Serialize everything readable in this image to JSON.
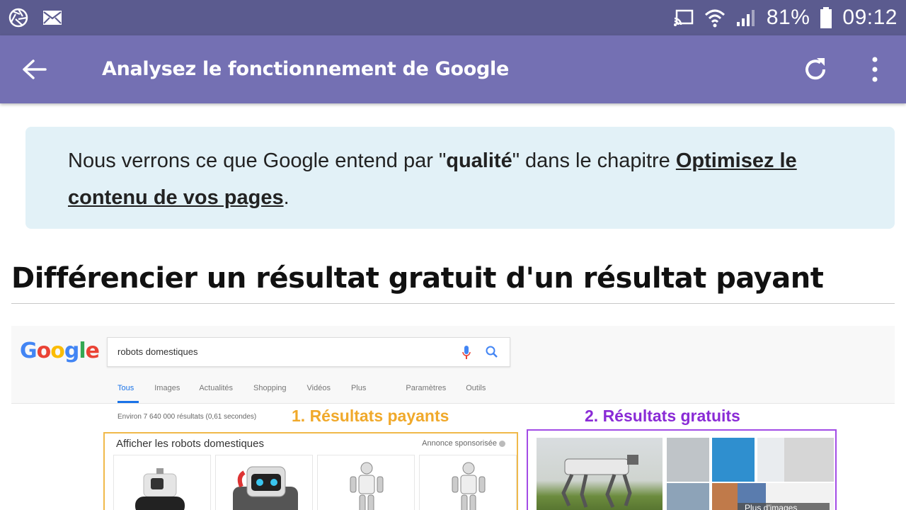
{
  "status_bar": {
    "battery": "81%",
    "time": "09:12",
    "icons": [
      "aperture-icon",
      "mail-icon",
      "cast-icon",
      "wifi-icon",
      "signal-icon",
      "battery-icon"
    ]
  },
  "app_bar": {
    "title": "Analysez le fonctionnement de Google",
    "icons": [
      "back-arrow-icon",
      "refresh-icon",
      "more-vert-icon"
    ]
  },
  "callout": {
    "text_before": "Nous verrons ce que Google entend par \"",
    "bold_word": "qualité",
    "text_middle": "\" dans le chapitre ",
    "link_text": "Optimisez le contenu de vos pages",
    "text_after": "."
  },
  "section": {
    "title": "Différencier un résultat gratuit d'un résultat payant"
  },
  "figure": {
    "logo": "Google",
    "search_query": "robots domestiques",
    "tabs": [
      "Tous",
      "Images",
      "Actualités",
      "Shopping",
      "Vidéos",
      "Plus",
      "Paramètres",
      "Outils"
    ],
    "results_count": "Environ 7 640 000 résultats (0,61 secondes)",
    "label_paid": "1. Résultats payants",
    "label_free": "2. Résultats gratuits",
    "paid_header": "Afficher les robots domestiques",
    "sponsored": "Annonce sponsorisée",
    "more_images": "Plus d'images"
  },
  "colors": {
    "status_bar": "#5b5b8f",
    "app_bar": "#7470b3",
    "callout_bg": "#e2f1f7",
    "paid_accent": "#f0a92b",
    "free_accent": "#8a2bd6"
  }
}
